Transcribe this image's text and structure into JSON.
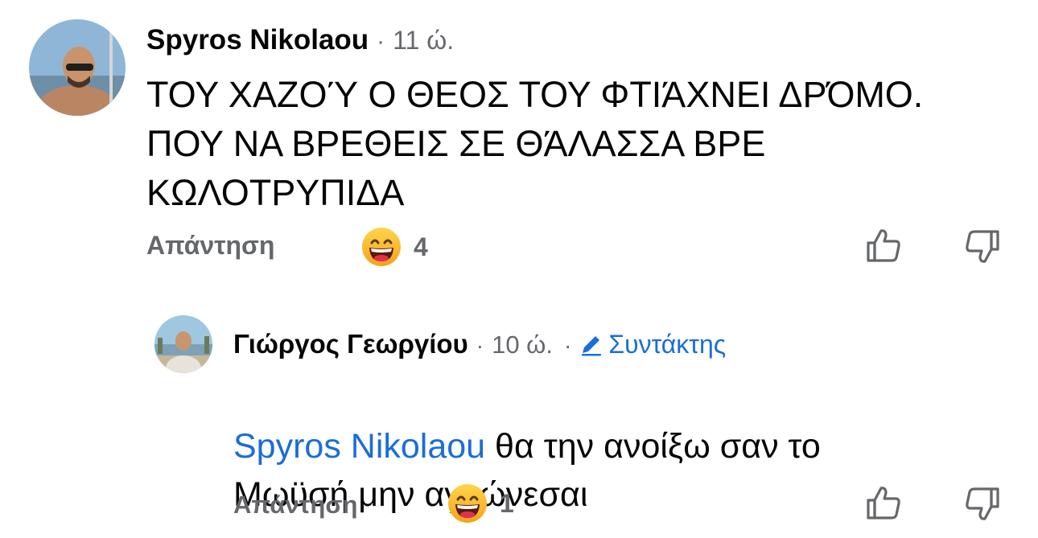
{
  "comments": [
    {
      "author": "Spyros Nikolaou",
      "separator": "·",
      "time": "11 ώ.",
      "text": "ΤΟΥ ΧΑΖΟΎ Ο ΘΕΟΣ ΤΟΥ ΦΤΙΆΧΝΕΙ ΔΡΌΜΟ.\nΠΟΥ ΝΑ ΒΡΕΘΕΙΣ ΣΕ ΘΆΛΑΣΣΑ ΒΡΕ\nΚΩΛΟΤΡΥΠΙΔΑ",
      "reply_label": "Απάντηση",
      "reaction_icon": "grinning-face-emoji",
      "reaction_count": "4"
    }
  ],
  "replies": [
    {
      "author": "Γιώργος Γεωργίου",
      "separator": "·",
      "time": "10 ώ.",
      "separator2": "·",
      "role_icon": "pencil-icon",
      "role": "Συντάκτης",
      "mention": "Spyros Nikolaou",
      "text": " θα την ανοίξω σαν το\nΜωϋσή μην αγχώνεσαι",
      "reply_label": "Απάντηση",
      "reaction_icon": "grinning-face-emoji",
      "reaction_count": "1"
    }
  ],
  "colors": {
    "accent": "#1a6ed8",
    "meta": "#65676b",
    "text": "#050505"
  }
}
